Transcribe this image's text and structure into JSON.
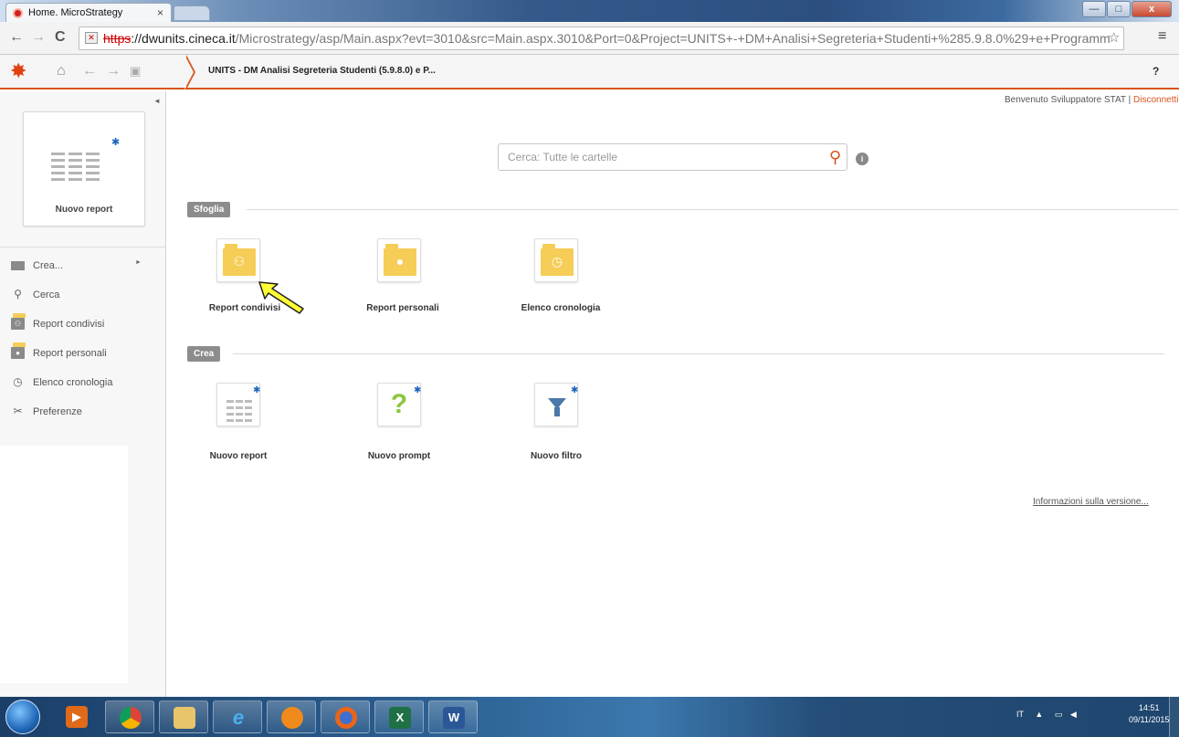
{
  "browser": {
    "tab_title": "Home. MicroStrategy",
    "tab_close": "×",
    "url_scheme": "https",
    "url_host": "://dwunits.cineca.it",
    "url_path": "/Microstrategy/asp/Main.aspx?evt=3010&src=Main.aspx.3010&Port=0&Project=UNITS+-+DM+Analisi+Segreteria+Studenti+%285.9.8.0%29+e+Programm",
    "back": "←",
    "forward": "→",
    "reload": "C",
    "bookmark_star": "☆",
    "menu": "≡"
  },
  "window_controls": {
    "minimize": "—",
    "maximize": "□",
    "close": "x"
  },
  "toolbar": {
    "breadcrumb": "UNITS - DM Analisi Segreteria Studenti (5.9.8.0) e P...",
    "help": "?"
  },
  "left_panel": {
    "new_report_label": "Nuovo report",
    "nav_items": [
      {
        "label": "Crea...",
        "icon": "create-icon"
      },
      {
        "label": "Cerca",
        "icon": "search-icon"
      },
      {
        "label": "Report condivisi",
        "icon": "shared-folder-icon"
      },
      {
        "label": "Report personali",
        "icon": "personal-folder-icon"
      },
      {
        "label": "Elenco cronologia",
        "icon": "history-clock-icon"
      },
      {
        "label": "Preferenze",
        "icon": "preferences-tools-icon"
      }
    ]
  },
  "header": {
    "welcome": "Benvenuto Sviluppatore STAT",
    "separator": "|",
    "logout": "Disconnetti"
  },
  "search": {
    "placeholder": "Cerca: Tutte le cartelle"
  },
  "sections": {
    "browse_title": "Sfoglia",
    "browse_items": [
      {
        "label": "Report condivisi",
        "icon": "shared-reports-folder-icon"
      },
      {
        "label": "Report personali",
        "icon": "personal-reports-folder-icon"
      },
      {
        "label": "Elenco cronologia",
        "icon": "history-list-folder-icon"
      }
    ],
    "create_title": "Crea",
    "create_items": [
      {
        "label": "Nuovo report",
        "icon": "new-report-grid-icon"
      },
      {
        "label": "Nuovo prompt",
        "icon": "question-mark-icon"
      },
      {
        "label": "Nuovo filtro",
        "icon": "filter-funnel-icon"
      }
    ]
  },
  "footer": {
    "version_link": "Informazioni sulla versione..."
  },
  "taskbar": {
    "language": "IT",
    "time": "14:51",
    "date": "09/11/2015"
  },
  "colors": {
    "accent": "#d9541e",
    "folder": "#f5cd57",
    "new_star": "#1a64b8",
    "prompt_green": "#8cc63f"
  }
}
